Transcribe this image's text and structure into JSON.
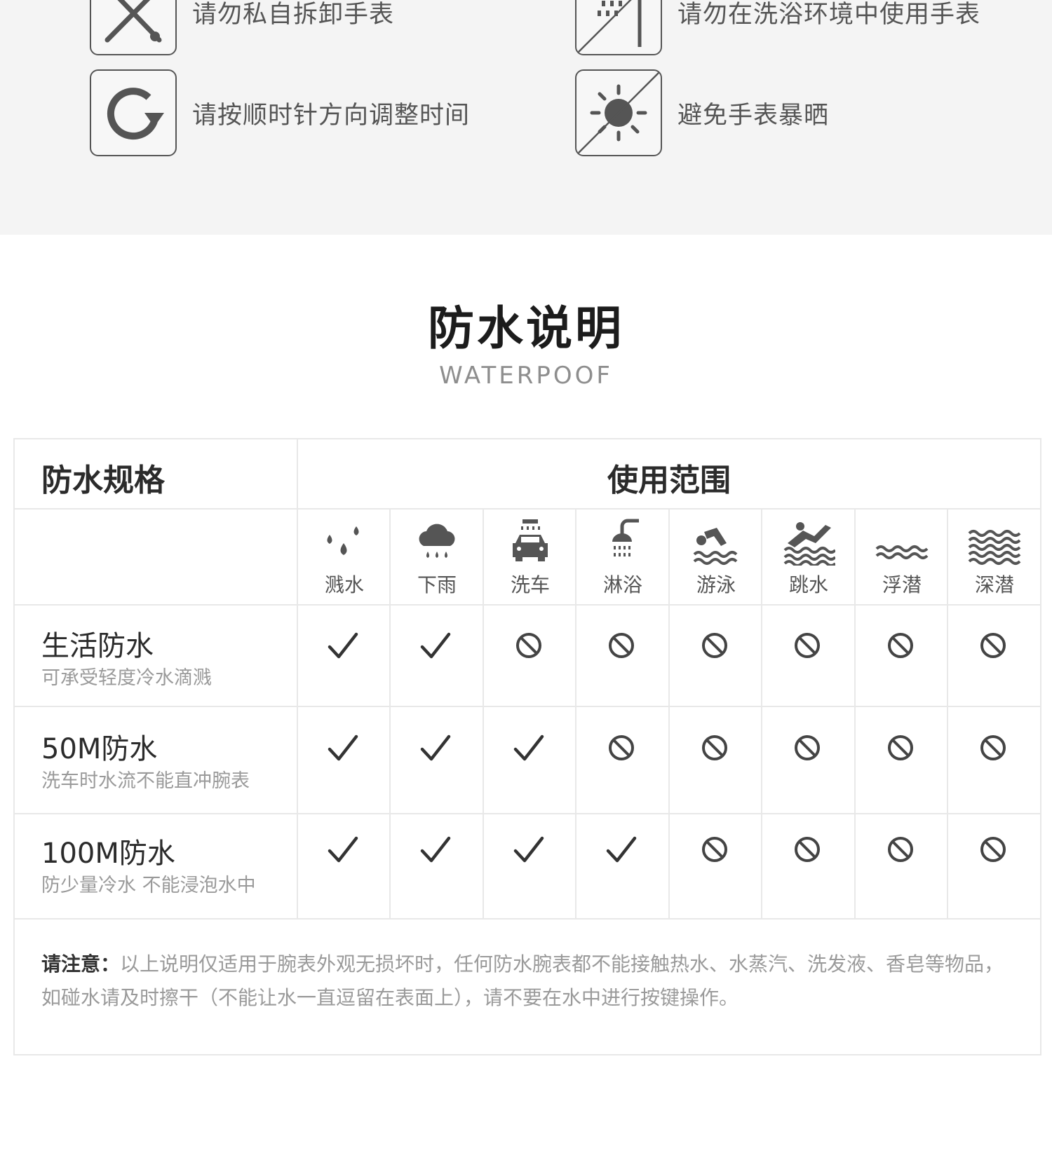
{
  "tips": [
    {
      "text": "请勿私自拆卸手表",
      "icon": "screwdriver-icon"
    },
    {
      "text": "请勿在洗浴环境中使用手表",
      "icon": "no-shower-icon"
    },
    {
      "text": "请按顺时针方向调整时间",
      "icon": "clockwise-arrow-icon"
    },
    {
      "text": "避免手表暴晒",
      "icon": "no-sun-icon"
    }
  ],
  "section": {
    "title": "防水说明",
    "subtitle": "WATERPOOF"
  },
  "table": {
    "spec_header": "防水规格",
    "scope_header": "使用范围",
    "activities": [
      {
        "label": "溅水",
        "icon": "splash-icon"
      },
      {
        "label": "下雨",
        "icon": "rain-icon"
      },
      {
        "label": "洗车",
        "icon": "car-wash-icon"
      },
      {
        "label": "淋浴",
        "icon": "shower-icon"
      },
      {
        "label": "游泳",
        "icon": "swim-icon"
      },
      {
        "label": "跳水",
        "icon": "dive-icon"
      },
      {
        "label": "浮潜",
        "icon": "snorkel-waves-icon"
      },
      {
        "label": "深潜",
        "icon": "deep-dive-waves-icon"
      }
    ],
    "rows": [
      {
        "title": "生活防水",
        "desc": "可承受轻度冷水滴溅",
        "support": [
          true,
          true,
          false,
          false,
          false,
          false,
          false,
          false
        ]
      },
      {
        "title": "50M防水",
        "desc": "洗车时水流不能直冲腕表",
        "support": [
          true,
          true,
          true,
          false,
          false,
          false,
          false,
          false
        ]
      },
      {
        "title": "100M防水",
        "desc": "防少量冷水 不能浸泡水中",
        "support": [
          true,
          true,
          true,
          true,
          false,
          false,
          false,
          false
        ]
      }
    ],
    "note_label": "请注意：",
    "note_text": "以上说明仅适用于腕表外观无损坏时，任何防水腕表都不能接触热水、水蒸汽、洗发液、香皂等物品，如碰水请及时擦干（不能让水一直逗留在表面上），请不要在水中进行按键操作。"
  },
  "colors": {
    "background": "#ffffff",
    "tips_background": "#f4f4f4",
    "grid_line": "#e8e8e8",
    "icon": "#555555"
  }
}
